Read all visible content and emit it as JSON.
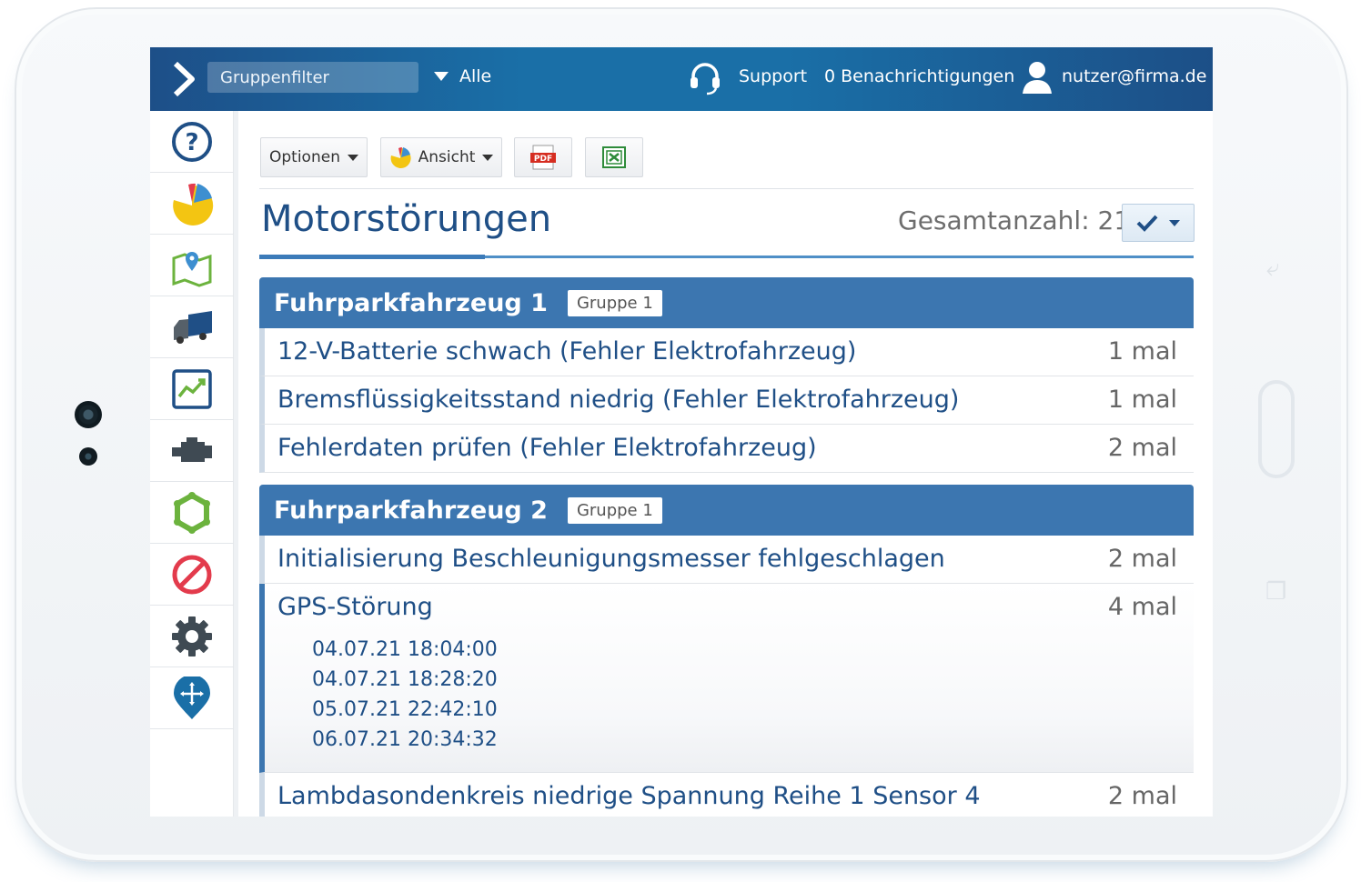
{
  "topbar": {
    "group_filter_placeholder": "Gruppenfilter",
    "group_select": "Alle",
    "support": "Support",
    "notifications": "0 Benachrichtigungen",
    "user": "nutzer@firma.de"
  },
  "sidebar": {
    "items": [
      "help-icon",
      "pie-chart-icon",
      "map-icon",
      "truck-icon",
      "trend-chart-icon",
      "engine-icon",
      "gear-outline-icon",
      "forbidden-icon",
      "settings-icon",
      "location-pin-icon"
    ]
  },
  "toolbar": {
    "options": "Optionen",
    "view": "Ansicht",
    "pdf": "PDF"
  },
  "page": {
    "title": "Motorstörungen",
    "total": "Gesamtanzahl: 21"
  },
  "groups": [
    {
      "title": "Fuhrparkfahrzeug 1",
      "badge": "Gruppe 1",
      "rows": [
        {
          "label": "12-V-Batterie schwach (Fehler Elektrofahrzeug)",
          "count": "1 mal"
        },
        {
          "label": "Bremsflüssigkeitsstand niedrig (Fehler Elektrofahrzeug)",
          "count": "1 mal"
        },
        {
          "label": "Fehlerdaten prüfen (Fehler Elektrofahrzeug)",
          "count": "2 mal"
        }
      ]
    },
    {
      "title": "Fuhrparkfahrzeug 2",
      "badge": "Gruppe 1",
      "rows": [
        {
          "label": "Initialisierung Beschleunigungsmesser fehlgeschlagen",
          "count": "2 mal"
        },
        {
          "label": "GPS-Störung",
          "count": "4 mal",
          "times": [
            "04.07.21 18:04:00",
            "04.07.21 18:28:20",
            "05.07.21 22:42:10",
            "06.07.21 20:34:32"
          ]
        },
        {
          "label": "Lambdasondenkreis niedrige Spannung Reihe 1 Sensor 4",
          "count": "2 mal"
        }
      ]
    }
  ],
  "colors": {
    "accent": "#3c76b0",
    "title": "#1f4f86",
    "topbar": "#1a6fa7"
  }
}
